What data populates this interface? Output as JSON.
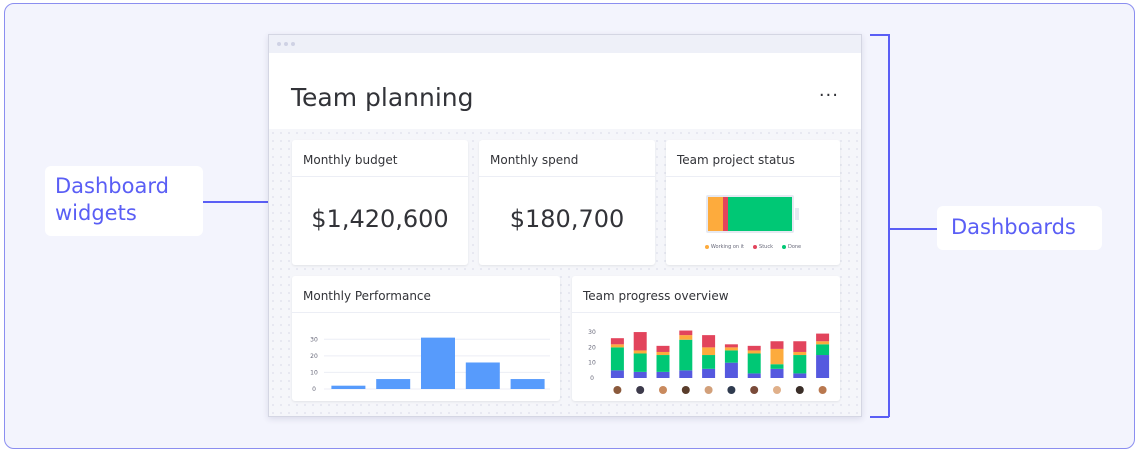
{
  "callouts": {
    "widgets_line1": "Dashboard",
    "widgets_line2": "widgets",
    "dashboards": "Dashboards"
  },
  "dashboard": {
    "title": "Team planning",
    "more_icon": "more-horizontal-icon",
    "more_label": "···"
  },
  "widgets": {
    "budget": {
      "title": "Monthly budget",
      "value": "$1,420,600"
    },
    "spend": {
      "title": "Monthly spend",
      "value": "$180,700"
    },
    "status": {
      "title": "Team project status",
      "legend": [
        {
          "label": "Working on it",
          "color": "#fdab3d",
          "share": 0.18
        },
        {
          "label": "Stuck",
          "color": "#e2445c",
          "share": 0.06
        },
        {
          "label": "Done",
          "color": "#00c875",
          "share": 0.76
        }
      ]
    },
    "performance": {
      "title": "Monthly Performance"
    },
    "progress": {
      "title": "Team progress overview"
    }
  },
  "colors": {
    "accent": "#5a5ef5",
    "bar_blue": "#579bfc",
    "working": "#fdab3d",
    "stuck": "#e2445c",
    "done": "#00c875",
    "in_progress": "#5559df"
  },
  "chart_data": [
    {
      "type": "bar",
      "chart": "performance",
      "yticks": [
        "30",
        "20",
        "10",
        "0"
      ],
      "ylim": [
        0,
        35
      ],
      "values": [
        2,
        6,
        31,
        16,
        6
      ],
      "grid": true
    },
    {
      "type": "bar",
      "chart": "progress",
      "stacked": true,
      "yticks": [
        "30",
        "20",
        "10",
        "0"
      ],
      "ylim": [
        0,
        32
      ],
      "series": [
        {
          "color": "#5559df",
          "values": [
            5,
            4,
            4,
            5,
            6,
            10,
            3,
            6,
            3,
            15
          ]
        },
        {
          "color": "#00c875",
          "values": [
            15,
            12,
            11,
            20,
            9,
            8,
            13,
            3,
            12,
            7
          ]
        },
        {
          "color": "#fdab3d",
          "values": [
            2,
            2,
            2,
            3,
            5,
            2,
            2,
            10,
            2,
            2
          ]
        },
        {
          "color": "#e2445c",
          "values": [
            4,
            12,
            4,
            3,
            8,
            2,
            3,
            5,
            7,
            5
          ]
        }
      ],
      "avatar_count": 10
    }
  ]
}
